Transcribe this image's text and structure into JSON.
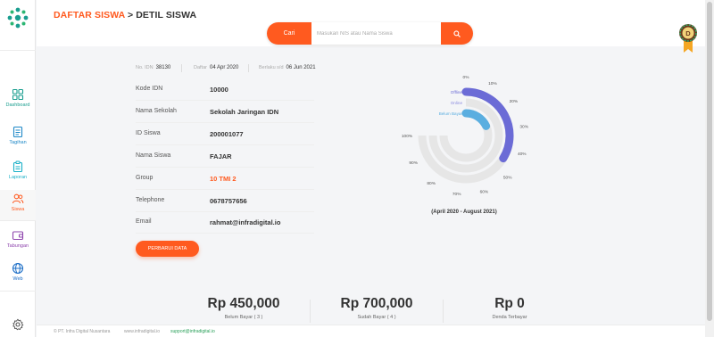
{
  "header": {
    "breadcrumb_parent": "DAFTAR SISWA",
    "breadcrumb_sep": " > ",
    "breadcrumb_current": "DETIL SISWA"
  },
  "search": {
    "button_label": "Cari",
    "placeholder": "Masukan NIS atau Nama Siswa"
  },
  "badge": {
    "letter": "D"
  },
  "sidebar": {
    "items": [
      {
        "label": "Dashboard",
        "color": "#1a9e8f"
      },
      {
        "label": "Tagihan",
        "color": "#1e88c7"
      },
      {
        "label": "Laporan",
        "color": "#1ab0c7"
      },
      {
        "label": "Siswa",
        "color": "#ff5a1f"
      },
      {
        "label": "Tabungan",
        "color": "#8e44ad"
      },
      {
        "label": "Web",
        "color": "#1e6fc7"
      }
    ]
  },
  "meta": {
    "id_label": "No. IDN",
    "id_value": "38130",
    "daftar_label": "Daftar",
    "daftar_value": "04 Apr 2020",
    "berlaku_label": "Berlaku s/d",
    "berlaku_value": "06 Jun 2021"
  },
  "profile": [
    {
      "label": "Kode IDN",
      "value": "10000"
    },
    {
      "label": "Nama Sekolah",
      "value": "Sekolah Jaringan IDN"
    },
    {
      "label": "ID Siswa",
      "value": "200001077"
    },
    {
      "label": "Nama Siswa",
      "value": "FAJAR"
    },
    {
      "label": "Group",
      "value": "10 TMI 2"
    },
    {
      "label": "Telephone",
      "value": "0678757656"
    },
    {
      "label": "Email",
      "value": "rahmat@infradigital.io"
    }
  ],
  "update_button": "PERBARUI DATA",
  "chart_data": {
    "type": "radialBar",
    "series": [
      {
        "name": "Offline",
        "value": 45,
        "color": "#6b6bd6"
      },
      {
        "name": "Online",
        "value": 0,
        "color": "#8c8ce0"
      },
      {
        "name": "Belum Bayar",
        "value": 24,
        "color": "#5aaee0"
      }
    ],
    "ticks": [
      "0%",
      "10%",
      "20%",
      "30%",
      "40%",
      "50%",
      "60%",
      "70%",
      "80%",
      "90%",
      "100%"
    ],
    "max_angle_deg": 270,
    "caption": "(April 2020 - August 2021)"
  },
  "stats": [
    {
      "amount": "Rp 450,000",
      "caption": "Belum Bayar ( 3 )"
    },
    {
      "amount": "Rp 700,000",
      "caption": "Sudah Bayar ( 4 )"
    },
    {
      "amount": "Rp 0",
      "caption": "Denda Terbayar"
    }
  ],
  "footer": {
    "company": "© PT. Infra Digital Nusantara",
    "site": "www.infradigital.io",
    "email": "support@infradigital.io"
  }
}
